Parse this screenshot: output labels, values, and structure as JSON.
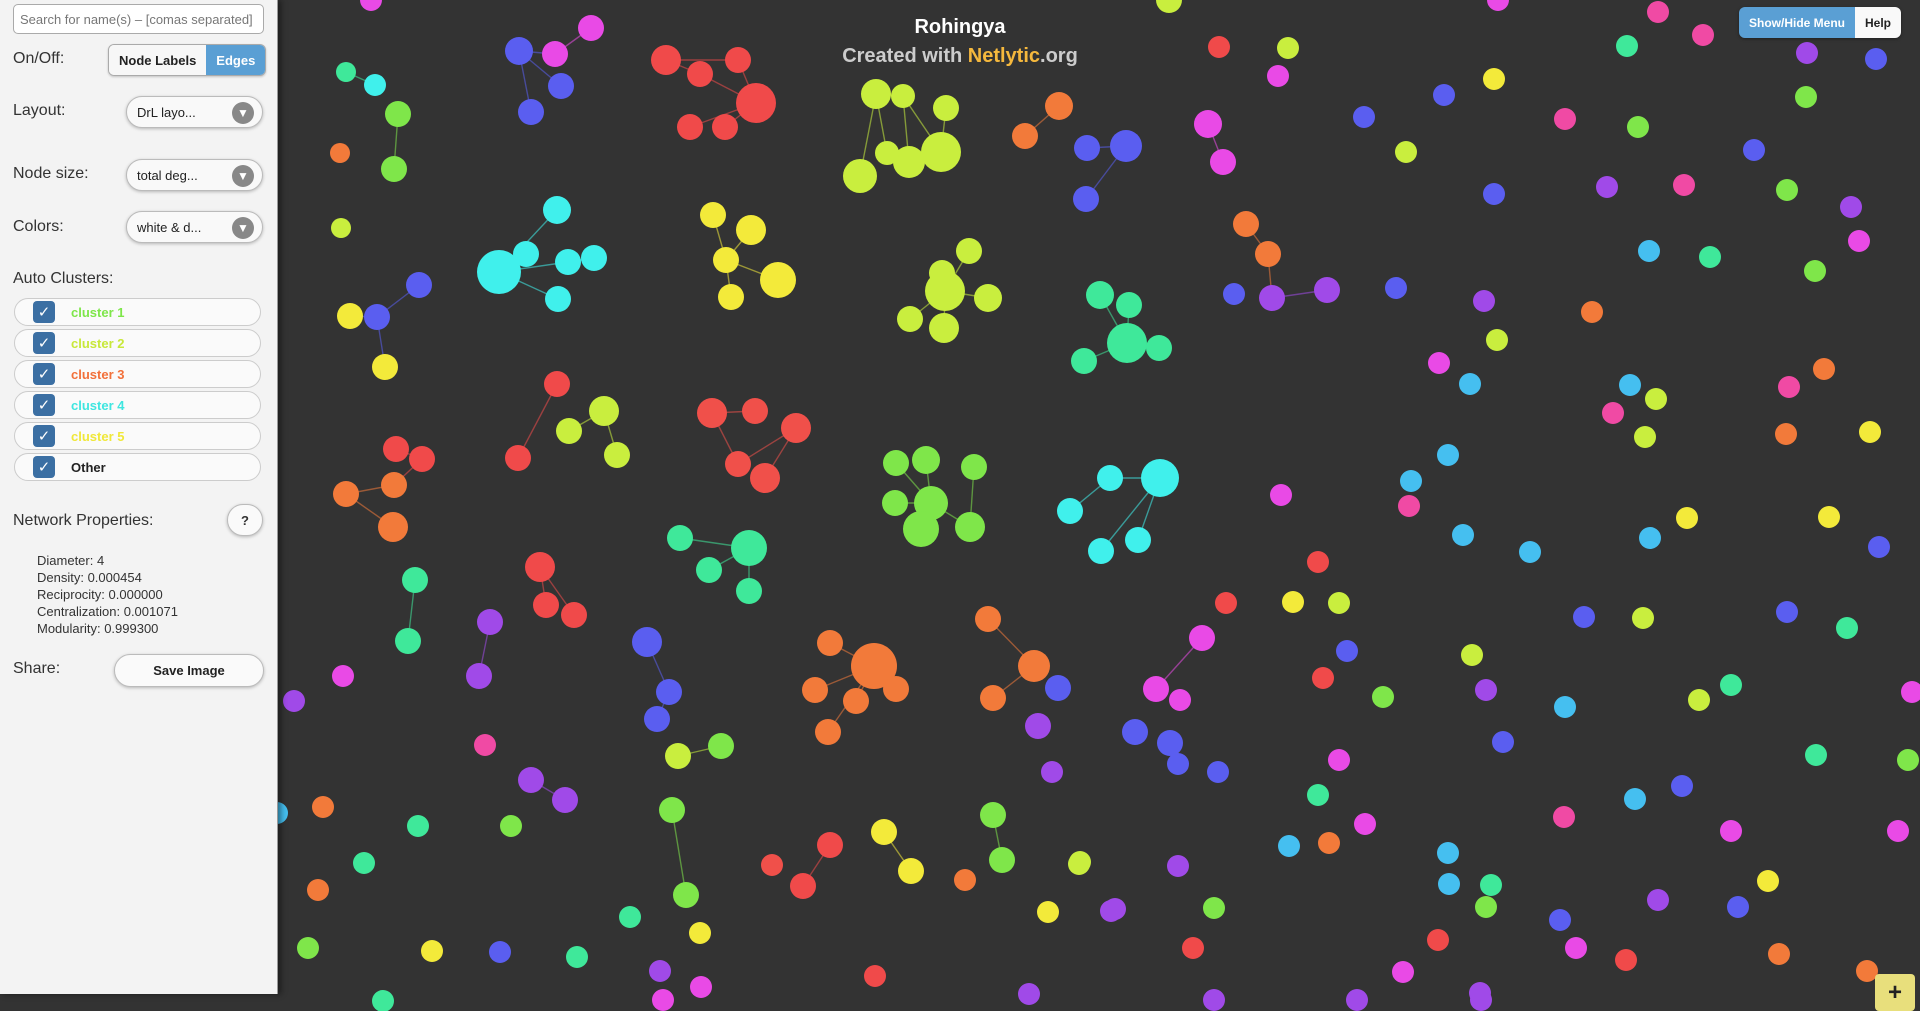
{
  "graph": {
    "title": "Rohingya",
    "subtitle_prefix": "Created with ",
    "brand": "Netlytic",
    "subtitle_suffix": ".org"
  },
  "top_menu": {
    "show_hide": "Show/Hide Menu",
    "help": "Help"
  },
  "sidebar": {
    "search_placeholder": "Search for name(s) – [comas separated]",
    "onoff_label": "On/Off:",
    "node_labels_btn": "Node Labels",
    "edges_btn": "Edges",
    "layout_label": "Layout:",
    "layout_value": "DrL layo...",
    "node_size_label": "Node size:",
    "node_size_value": "total deg...",
    "colors_label": "Colors:",
    "colors_value": "white & d...",
    "auto_clusters_label": "Auto Clusters:",
    "clusters": [
      {
        "label": "cluster 1",
        "color": "#7ee64a"
      },
      {
        "label": "cluster 2",
        "color": "#c8e83a"
      },
      {
        "label": "cluster 3",
        "color": "#f2703a"
      },
      {
        "label": "cluster 4",
        "color": "#3fe6e0"
      },
      {
        "label": "cluster 5",
        "color": "#f0e83a"
      },
      {
        "label": "Other",
        "color": "#222222"
      }
    ],
    "network_props_label": "Network Properties:",
    "help_q": "?",
    "props": {
      "diameter": "Diameter: 4",
      "density": "Density: 0.000454",
      "reciprocity": "Reciprocity: 0.000000",
      "centralization": "Centralization: 0.001071",
      "modularity": "Modularity: 0.999300"
    },
    "share_label": "Share:",
    "save_image": "Save Image"
  },
  "zoom": {
    "plus": "+"
  },
  "colors": {
    "background": "#333333",
    "accent": "#5a9fd4",
    "brand": "#f5b83d"
  }
}
